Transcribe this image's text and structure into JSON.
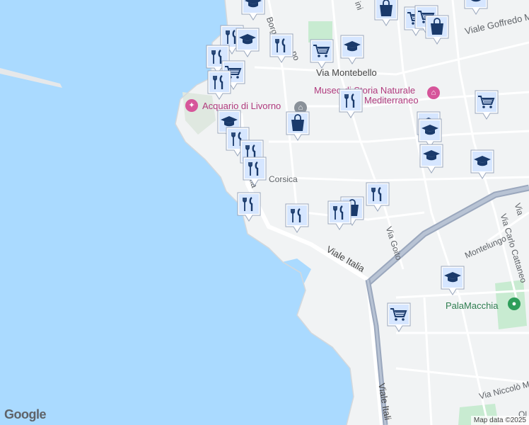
{
  "colors": {
    "water": "#aadaff",
    "land": "#f1f3f4",
    "road": "#ffffff",
    "highway": "#9aa7bd",
    "park": "#c8ebd1",
    "pin_fill": "#1a3a6b",
    "pin_bg": "#d6e6ff",
    "poi_pink": "#d6559a",
    "poi_grey": "#8a9199",
    "poi_green": "#2e9e5a"
  },
  "streets": {
    "viale_goffredo": "Viale Goffredo M",
    "via_montebello": "Via Montebello",
    "borgo": "Borgo",
    "po": "po",
    "corsica": "Corsica",
    "viale_italia_1": "Viale Italia",
    "viale_italia_2": "Viale Italia",
    "viale_italia_3": "Viale Itali",
    "via_goito": "Via Goito",
    "via_montelungo": "Montelungo",
    "via_carlo_cattaneo": "Via Carlo Cattaneo",
    "via_niccolo": "Via Niccolò Mac",
    "via_top": "ini",
    "via_right": "Via",
    "via_ol": "Ol"
  },
  "pois": {
    "acquario": "Acquario di Livorno",
    "museo_line1": "Museo di Storia Naturale",
    "museo_line2": "Mediterraneo",
    "palamacchia": "PalaMacchia"
  },
  "attribution": {
    "logo": "Google",
    "map_data": "Map data ©2025"
  },
  "markers": [
    {
      "type": "school",
      "name": "school-marker"
    },
    {
      "type": "shopping",
      "name": "shopping-marker"
    },
    {
      "type": "cart",
      "name": "cart-marker"
    },
    {
      "type": "cart",
      "name": "cart-marker"
    },
    {
      "type": "school",
      "name": "school-marker"
    },
    {
      "type": "restaurant",
      "name": "restaurant-marker"
    },
    {
      "type": "school",
      "name": "school-marker"
    },
    {
      "type": "restaurant",
      "name": "restaurant-marker"
    },
    {
      "type": "cart",
      "name": "cart-marker"
    },
    {
      "type": "school",
      "name": "school-marker"
    },
    {
      "type": "restaurant",
      "name": "restaurant-marker"
    },
    {
      "type": "cart",
      "name": "cart-marker"
    },
    {
      "type": "restaurant",
      "name": "restaurant-marker"
    },
    {
      "type": "shopping",
      "name": "shopping-marker"
    },
    {
      "type": "restaurant",
      "name": "restaurant-marker"
    },
    {
      "type": "school",
      "name": "school-marker"
    },
    {
      "type": "restaurant",
      "name": "restaurant-marker"
    },
    {
      "type": "school",
      "name": "school-marker"
    },
    {
      "type": "restaurant",
      "name": "restaurant-marker"
    },
    {
      "type": "cart",
      "name": "cart-marker"
    },
    {
      "type": "restaurant",
      "name": "restaurant-marker"
    },
    {
      "type": "shopping",
      "name": "shopping-marker"
    },
    {
      "type": "school",
      "name": "school-marker"
    },
    {
      "type": "school",
      "name": "school-marker"
    },
    {
      "type": "restaurant",
      "name": "restaurant-marker"
    },
    {
      "type": "restaurant",
      "name": "restaurant-marker"
    },
    {
      "type": "shopping",
      "name": "shopping-marker"
    },
    {
      "type": "restaurant",
      "name": "restaurant-marker"
    },
    {
      "type": "restaurant",
      "name": "restaurant-marker"
    },
    {
      "type": "school",
      "name": "school-marker"
    },
    {
      "type": "cart",
      "name": "cart-marker"
    },
    {
      "type": "school",
      "name": "school-marker"
    }
  ]
}
